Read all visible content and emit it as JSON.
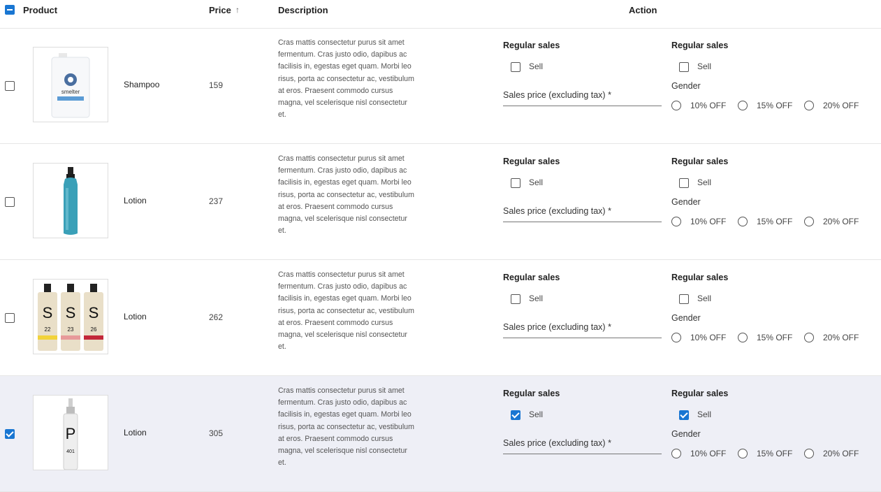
{
  "header": {
    "product": "Product",
    "price": "Price",
    "price_sort_arrow": "↑",
    "description": "Description",
    "action": "Action"
  },
  "colors": {
    "accent": "#1976d2",
    "selected_row": "#eeeff6"
  },
  "rows": [
    {
      "checked": false,
      "image": "shampoo-bottle-image",
      "name": "Shampoo",
      "price": "159",
      "description": "Cras mattis consectetur purus sit amet fermentum. Cras justo odio, dapibus ac facilisis in, egestas eget quam. Morbi leo risus, porta ac consectetur ac, vestibulum at eros. Praesent commodo cursus magna, vel scelerisque nisl consectetur et.",
      "section1_title": "Regular sales",
      "section1_sell": "Sell",
      "section1_checked": false,
      "sales_price_label": "Sales price (excluding tax) *",
      "section2_title": "Regular sales",
      "section2_sell": "Sell",
      "section2_checked": false,
      "gender_label": "Gender",
      "options": [
        "10% OFF",
        "15% OFF",
        "20% OFF"
      ],
      "bottle_label": "smelter"
    },
    {
      "checked": false,
      "image": "lotion-bottle-image",
      "name": "Lotion",
      "price": "237",
      "description": "Cras mattis consectetur purus sit amet fermentum. Cras justo odio, dapibus ac facilisis in, egestas eget quam. Morbi leo risus, porta ac consectetur ac, vestibulum at eros. Praesent commodo cursus magna, vel scelerisque nisl consectetur et.",
      "section1_title": "Regular sales",
      "section1_sell": "Sell",
      "section1_checked": false,
      "sales_price_label": "Sales price (excluding tax) *",
      "section2_title": "Regular sales",
      "section2_sell": "Sell",
      "section2_checked": false,
      "gender_label": "Gender",
      "options": [
        "10% OFF",
        "15% OFF",
        "20% OFF"
      ]
    },
    {
      "checked": false,
      "image": "three-bottles-image",
      "name": "Lotion",
      "price": "262",
      "description": "Cras mattis consectetur purus sit amet fermentum. Cras justo odio, dapibus ac facilisis in, egestas eget quam. Morbi leo risus, porta ac consectetur ac, vestibulum at eros. Praesent commodo cursus magna, vel scelerisque nisl consectetur et.",
      "section1_title": "Regular sales",
      "section1_sell": "Sell",
      "section1_checked": false,
      "sales_price_label": "Sales price (excluding tax) *",
      "section2_title": "Regular sales",
      "section2_sell": "Sell",
      "section2_checked": false,
      "gender_label": "Gender",
      "options": [
        "10% OFF",
        "15% OFF",
        "20% OFF"
      ],
      "bottle_letters": [
        "S",
        "S",
        "S"
      ],
      "bottle_numbers": [
        "22",
        "23",
        "26"
      ]
    },
    {
      "checked": true,
      "image": "spray-bottle-image",
      "name": "Lotion",
      "price": "305",
      "description": "Cras mattis consectetur purus sit amet fermentum. Cras justo odio, dapibus ac facilisis in, egestas eget quam. Morbi leo risus, porta ac consectetur ac, vestibulum at eros. Praesent commodo cursus magna, vel scelerisque nisl consectetur et.",
      "section1_title": "Regular sales",
      "section1_sell": "Sell",
      "section1_checked": true,
      "sales_price_label": "Sales price (excluding tax) *",
      "section2_title": "Regular sales",
      "section2_sell": "Sell",
      "section2_checked": true,
      "gender_label": "Gender",
      "options": [
        "10% OFF",
        "15% OFF",
        "20% OFF"
      ],
      "bottle_letter": "P",
      "bottle_number": "401"
    }
  ]
}
